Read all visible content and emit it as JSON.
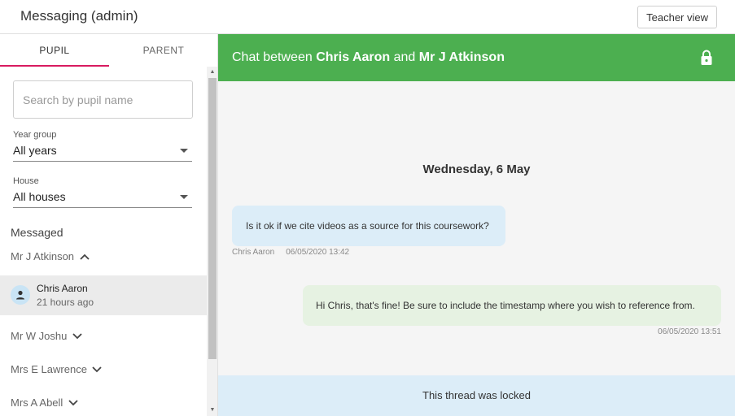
{
  "app": {
    "title": "Messaging (admin)",
    "teacher_view_label": "Teacher view"
  },
  "tabs": [
    {
      "label": "PUPIL",
      "active": true
    },
    {
      "label": "PARENT",
      "active": false
    }
  ],
  "search": {
    "placeholder": "Search by pupil name",
    "value": ""
  },
  "filters": {
    "year": {
      "label": "Year group",
      "value": "All years"
    },
    "house": {
      "label": "House",
      "value": "All houses"
    }
  },
  "messaged": {
    "header": "Messaged",
    "groups": [
      {
        "name": "Mr J Atkinson",
        "expanded": true
      },
      {
        "name": "Mr W Joshu",
        "expanded": false
      },
      {
        "name": "Mrs E Lawrence",
        "expanded": false
      },
      {
        "name": "Mrs A Abell",
        "expanded": false
      }
    ],
    "selected_thread": {
      "name": "Chris Aaron",
      "time": "21 hours ago"
    }
  },
  "chat": {
    "title_prefix": "Chat between ",
    "participant_a": "Chris Aaron",
    "title_joiner": " and ",
    "participant_b": "Mr J Atkinson",
    "date_divider": "Wednesday, 6 May",
    "messages": [
      {
        "direction": "in",
        "text": "Is it ok if we cite videos as a source for this coursework?",
        "author": "Chris Aaron",
        "timestamp": "06/05/2020 13:42"
      },
      {
        "direction": "out",
        "text": "Hi Chris, that's fine! Be sure to include the timestamp where you wish to reference from.",
        "author": "",
        "timestamp": "06/05/2020 13:51"
      }
    ],
    "locked_notice": "This thread was locked"
  },
  "colors": {
    "header_green": "#4caf50",
    "tab_indicator": "#d81b60",
    "incoming_bubble": "#dcedf8",
    "outgoing_bubble": "#e6f2e2"
  },
  "icons": {
    "lock": "lock-icon",
    "avatar": "person-icon",
    "chevron_up": "chevron-up-icon",
    "chevron_down": "chevron-down-icon"
  }
}
